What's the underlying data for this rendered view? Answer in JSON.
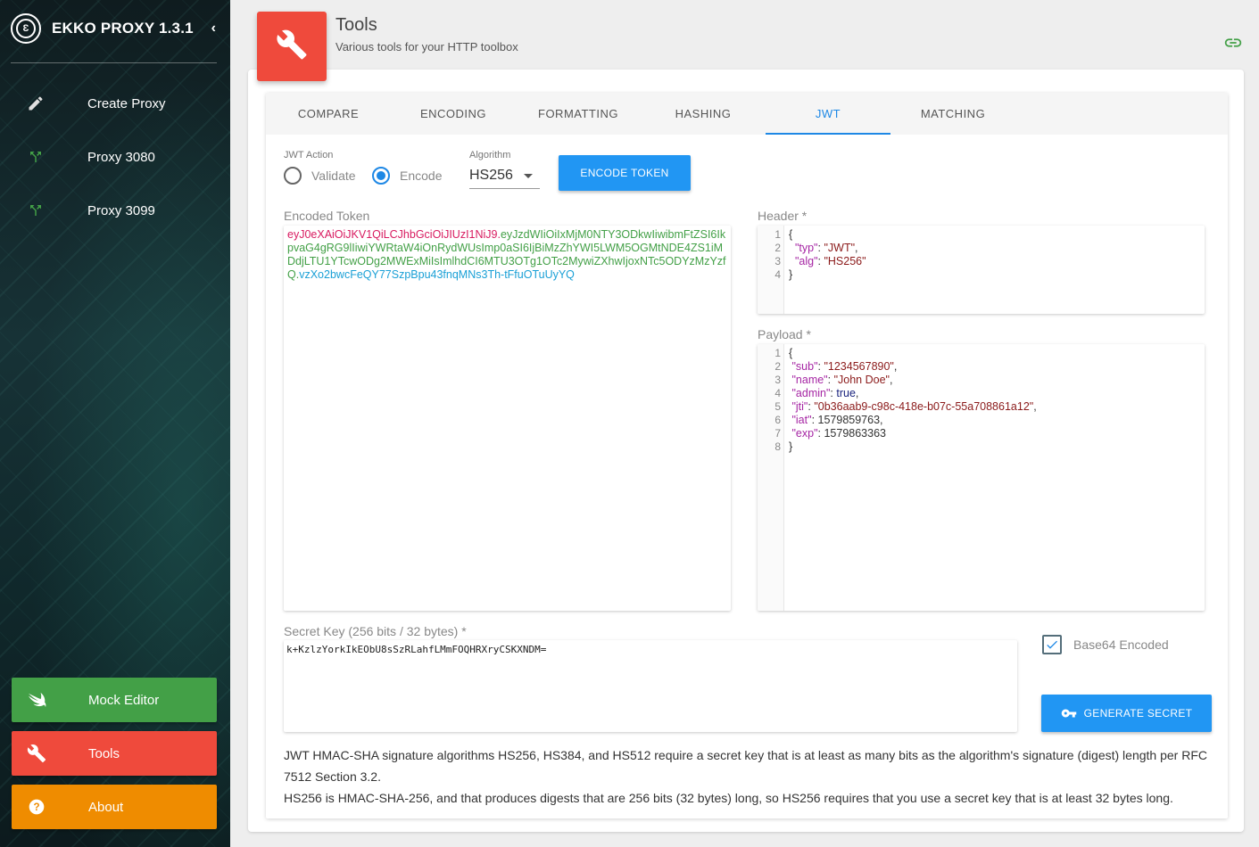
{
  "app": {
    "title": "EKKO PROXY 1.3.1",
    "collapse_icon": "chevron-left-icon"
  },
  "sidebar": {
    "items": [
      {
        "label": "Create Proxy",
        "icon": "pencil-icon"
      },
      {
        "label": "Proxy 3080",
        "icon": "split-arrow-icon"
      },
      {
        "label": "Proxy 3099",
        "icon": "split-arrow-icon"
      }
    ],
    "buttons": [
      {
        "label": "Mock Editor",
        "icon": "swift-bird-icon",
        "color": "#43a047"
      },
      {
        "label": "Tools",
        "icon": "wrench-icon",
        "color": "#ef4a3c"
      },
      {
        "label": "About",
        "icon": "help-circle-icon",
        "color": "#ef8c00"
      }
    ]
  },
  "header": {
    "title": "Tools",
    "subtitle": "Various tools for your HTTP toolbox"
  },
  "tabs": [
    {
      "label": "COMPARE",
      "active": false
    },
    {
      "label": "ENCODING",
      "active": false
    },
    {
      "label": "FORMATTING",
      "active": false
    },
    {
      "label": "HASHING",
      "active": false
    },
    {
      "label": "JWT",
      "active": true
    },
    {
      "label": "MATCHING",
      "active": false
    }
  ],
  "jwt": {
    "action_label": "JWT Action",
    "validate_label": "Validate",
    "encode_label": "Encode",
    "selected_action": "Encode",
    "algorithm_label": "Algorithm",
    "algorithm_value": "HS256",
    "encode_button": "ENCODE TOKEN",
    "encoded_token_label": "Encoded Token",
    "token_header": "eyJ0eXAiOiJKV1QiLCJhbGciOiJIUzI1NiJ9",
    "token_payload": "eyJzdWIiOiIxMjM0NTY3ODkwIiwibmFtZSI6IkpvaG4gRG9lIiwiYWRtaW4iOnRydWUsImp0aSI6IjBiMzZhYWI5LWM5OGMtNDE4ZS1iMDdjLTU1YTcwODg2MWExMiIsImlhdCI6MTU3OTg1OTc2MywiZXhwIjoxNTc5ODYzMzYzfQ",
    "token_signature": "vzXo2bwcFeQY77SzpBpu43fnqMNs3Th-tFfuOTuUyYQ",
    "header_label": "Header *",
    "header_lines": [
      {
        "n": "1",
        "parts": [
          {
            "t": "{",
            "c": "n"
          }
        ]
      },
      {
        "n": "2",
        "parts": [
          {
            "t": "  \"typ\"",
            "c": "k"
          },
          {
            "t": ": ",
            "c": "n"
          },
          {
            "t": "\"JWT\"",
            "c": "s"
          },
          {
            "t": ",",
            "c": "n"
          }
        ]
      },
      {
        "n": "3",
        "parts": [
          {
            "t": "  \"alg\"",
            "c": "k"
          },
          {
            "t": ": ",
            "c": "n"
          },
          {
            "t": "\"HS256\"",
            "c": "s"
          }
        ]
      },
      {
        "n": "4",
        "parts": [
          {
            "t": "}",
            "c": "n"
          }
        ]
      }
    ],
    "payload_label": "Payload *",
    "payload_lines": [
      {
        "n": "1",
        "parts": [
          {
            "t": "{",
            "c": "n"
          }
        ]
      },
      {
        "n": "2",
        "parts": [
          {
            "t": " \"sub\"",
            "c": "k"
          },
          {
            "t": ": ",
            "c": "n"
          },
          {
            "t": "\"1234567890\"",
            "c": "s"
          },
          {
            "t": ",",
            "c": "n"
          }
        ]
      },
      {
        "n": "3",
        "parts": [
          {
            "t": " \"name\"",
            "c": "k"
          },
          {
            "t": ": ",
            "c": "n"
          },
          {
            "t": "\"John Doe\"",
            "c": "s"
          },
          {
            "t": ",",
            "c": "n"
          }
        ]
      },
      {
        "n": "4",
        "parts": [
          {
            "t": " \"admin\"",
            "c": "k"
          },
          {
            "t": ": ",
            "c": "n"
          },
          {
            "t": "true",
            "c": "b"
          },
          {
            "t": ",",
            "c": "n"
          }
        ]
      },
      {
        "n": "5",
        "parts": [
          {
            "t": " \"jti\"",
            "c": "k"
          },
          {
            "t": ": ",
            "c": "n"
          },
          {
            "t": "\"0b36aab9-c98c-418e-b07c-55a708861a12\"",
            "c": "s"
          },
          {
            "t": ",",
            "c": "n"
          }
        ]
      },
      {
        "n": "6",
        "parts": [
          {
            "t": " \"iat\"",
            "c": "k"
          },
          {
            "t": ": ",
            "c": "n"
          },
          {
            "t": "1579859763",
            "c": "n"
          },
          {
            "t": ",",
            "c": "n"
          }
        ]
      },
      {
        "n": "7",
        "parts": [
          {
            "t": " \"exp\"",
            "c": "k"
          },
          {
            "t": ": ",
            "c": "n"
          },
          {
            "t": "1579863363",
            "c": "n"
          }
        ]
      },
      {
        "n": "8",
        "parts": [
          {
            "t": "}",
            "c": "n"
          }
        ]
      }
    ],
    "secret_label": "Secret Key (256 bits / 32 bytes) *",
    "secret_value": "k+KzlzYorkIkEObU8sSzRLahfLMmFOQHRXryCSKXNDM=",
    "base64_label": "Base64 Encoded",
    "base64_checked": true,
    "generate_button": "GENERATE SECRET",
    "info_line1": "JWT HMAC-SHA signature algorithms HS256, HS384, and HS512 require a secret key that is at least as many bits as the algorithm's signature (digest) length per RFC 7512 Section 3.2.",
    "info_line2": "HS256 is HMAC-SHA-256, and that produces digests that are 256 bits (32 bytes) long, so HS256 requires that you use a secret key that is at least 32 bytes long."
  },
  "colors": {
    "accent": "#2196f3",
    "tab_active": "#1e88e5",
    "tools_badge": "#ef4a3c",
    "link_icon": "#43a047"
  }
}
